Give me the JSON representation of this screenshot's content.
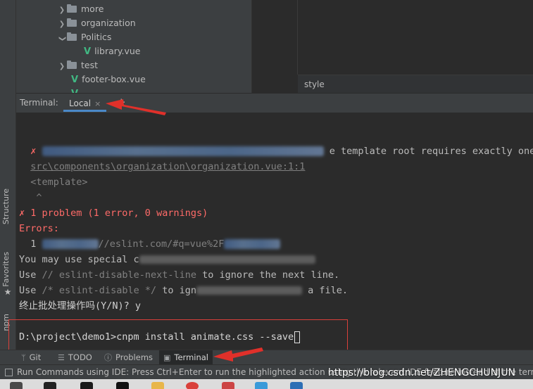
{
  "project_tree": {
    "items": [
      {
        "label": "more",
        "type": "folder",
        "expanded": false
      },
      {
        "label": "organization",
        "type": "folder",
        "expanded": false
      },
      {
        "label": "Politics",
        "type": "folder",
        "expanded": true
      },
      {
        "label": "library.vue",
        "type": "vue-file"
      },
      {
        "label": "test",
        "type": "folder",
        "expanded": false
      },
      {
        "label": "footer-box.vue",
        "type": "vue-file"
      }
    ]
  },
  "editor": {
    "status_label": "style"
  },
  "terminal": {
    "title": "Terminal:",
    "tab_label": "Local",
    "close_glyph": "×",
    "add_glyph": "+",
    "lines": {
      "error_mark": "✗",
      "error_tail": "e template root requires exactly one",
      "error_location": "src\\components\\organization\\organization.vue:1:1",
      "template_tag": "<template>",
      "caret": "^",
      "problem_summary": "✗ 1 problem (1 error, 0 warnings)",
      "errors_heading": "Errors:",
      "errors_index": "1",
      "errors_url_fragment": "//eslint.com/#q=vue%2F",
      "may_use": "You may use special c",
      "use_word": "Use",
      "disable_next_line": "// eslint-disable-next-line",
      "ignore_next": "to ignore the next line.",
      "disable_block": "/* eslint-disable */",
      "ignore_file_start": "to ign",
      "ignore_file_end": "a file.",
      "batch_prompt": "终止批处理操作吗(Y/N)? y",
      "command_line": "D:\\project\\demo1>cnpm install animate.css --save"
    }
  },
  "left_strip": {
    "structure": "Structure",
    "favorites": "Favorites",
    "npm": "npm"
  },
  "bottom_tabs": {
    "git": "Git",
    "todo": "TODO",
    "problems": "Problems",
    "terminal": "Terminal",
    "active": "Terminal"
  },
  "status_bar": {
    "text": "Run Commands using IDE: Press Ctrl+Enter to run the highlighted action using the relevant IDE feature instead of the termina"
  },
  "watermark": "https://blog.csdn.net/ZHENGCHUNJUN",
  "colors": {
    "background": "#2b2b2b",
    "panel": "#3c3f41",
    "error_red": "#ff6b68",
    "vue_green": "#41b883",
    "annotation_red": "#d9403a",
    "tab_underline": "#4a88c7"
  }
}
